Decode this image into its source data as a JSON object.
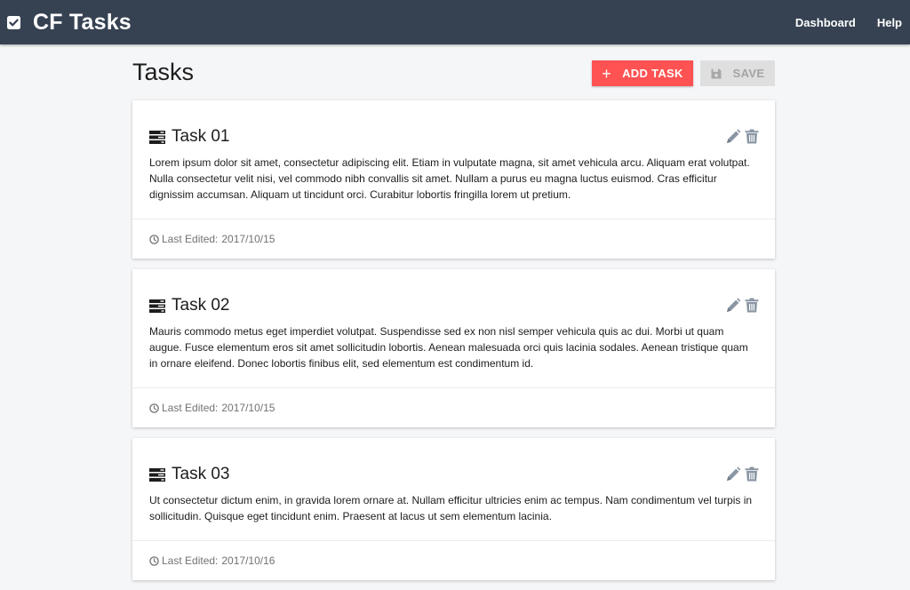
{
  "navbar": {
    "brand_icon": "checkbox-checked-icon",
    "title": "CF Tasks",
    "links": [
      "Dashboard",
      "Help"
    ]
  },
  "page": {
    "title": "Tasks"
  },
  "toolbar": {
    "add_label": "ADD TASK",
    "add_icon": "plus-icon",
    "save_label": "SAVE",
    "save_icon": "floppy-disk-icon"
  },
  "tasks": [
    {
      "title": "Task 01",
      "description": "Lorem ipsum dolor sit amet, consectetur adipiscing elit. Etiam in vulputate magna, sit amet vehicula arcu. Aliquam erat volutpat. Nulla consectetur velit nisi, vel commodo nibh convallis sit amet. Nullam a purus eu magna luctus euismod. Cras efficitur dignissim accumsan. Aliquam ut tincidunt orci. Curabitur lobortis fringilla lorem ut pretium.",
      "footer_label": "Last Edited:",
      "date": "2017/10/15"
    },
    {
      "title": "Task 02",
      "description": "Mauris commodo metus eget imperdiet volutpat. Suspendisse sed ex non nisl semper vehicula quis ac dui. Morbi ut quam augue. Fusce elementum eros sit amet sollicitudin lobortis. Aenean malesuada orci quis lacinia sodales. Aenean tristique quam in ornare eleifend. Donec lobortis finibus elit, sed elementum est condimentum id.",
      "footer_label": "Last Edited:",
      "date": "2017/10/15"
    },
    {
      "title": "Task 03",
      "description": "Ut consectetur dictum enim, in gravida lorem ornare at. Nullam efficitur ultricies enim ac tempus. Nam condimentum vel turpis in sollicitudin. Quisque eget tincidunt enim. Praesent at lacus ut sem elementum lacinia.",
      "footer_label": "Last Edited:",
      "date": "2017/10/16"
    }
  ],
  "icons": {
    "task": "server-rack-icon",
    "edit": "pencil-icon",
    "delete": "trash-icon",
    "timestamp": "clock-icon"
  },
  "colors": {
    "navbar": "#364252",
    "accent": "#ff5252",
    "disabled": "#dfdfdf",
    "action_icon": "#8a96a3"
  }
}
